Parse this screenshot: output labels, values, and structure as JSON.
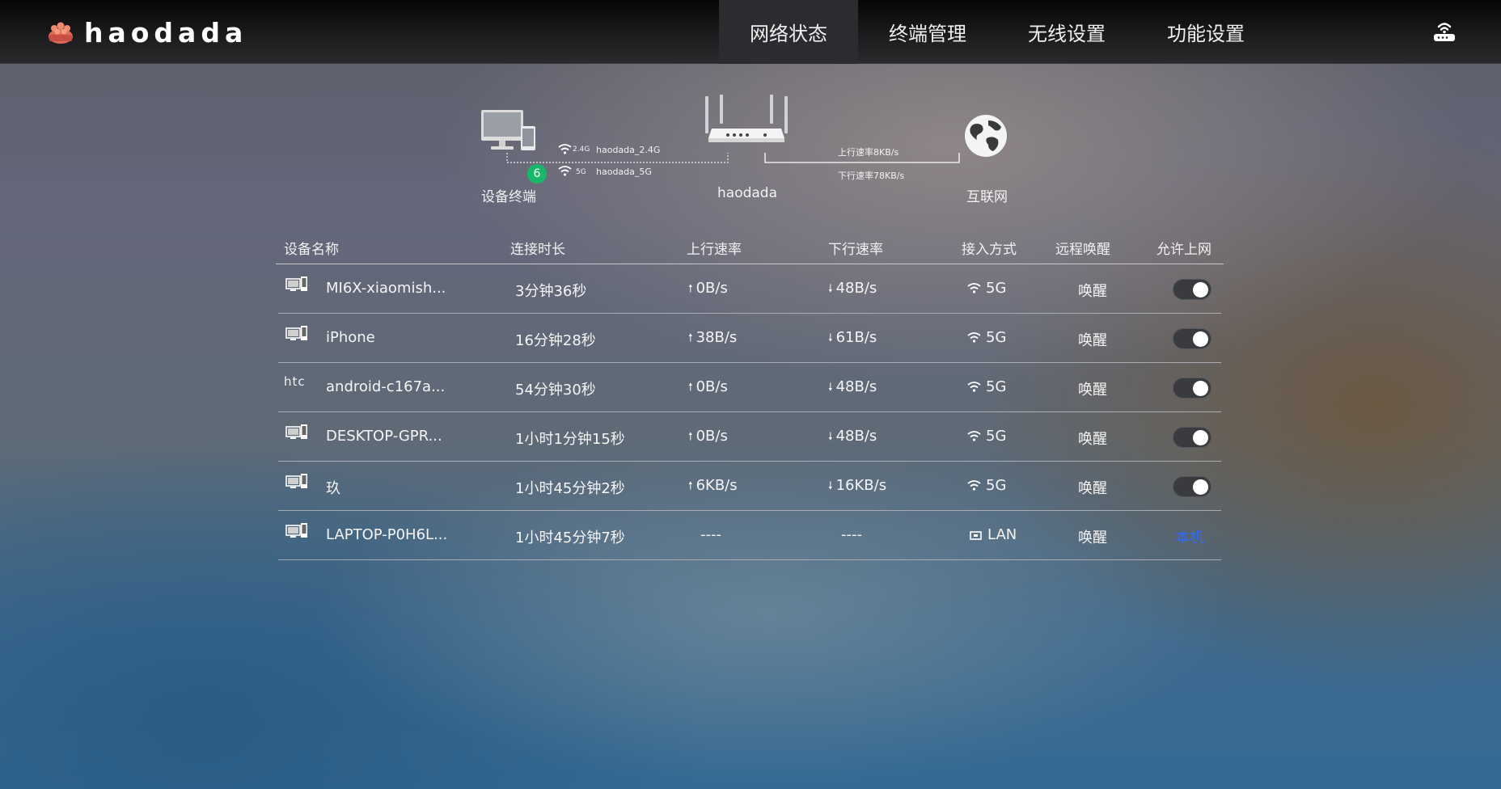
{
  "header": {
    "brand": "haodada",
    "nav": [
      {
        "label": "网络状态",
        "active": true
      },
      {
        "label": "终端管理",
        "active": false
      },
      {
        "label": "无线设置",
        "active": false
      },
      {
        "label": "功能设置",
        "active": false
      }
    ],
    "router_icon": "router-icon"
  },
  "topology": {
    "devices_label": "设备终端",
    "device_count": "6",
    "ssid_24_band": "2.4G",
    "ssid_24": "haodada_2.4G",
    "ssid_5_band": "5G",
    "ssid_5": "haodada_5G",
    "router_label": "haodada",
    "upload_rate": "上行速率8KB/s",
    "download_rate": "下行速率78KB/s",
    "internet_label": "互联网"
  },
  "table": {
    "headers": {
      "name": "设备名称",
      "duration": "连接时长",
      "up": "上行速率",
      "down": "下行速率",
      "access": "接入方式",
      "wake": "远程唤醒",
      "allow": "允许上网"
    },
    "rows": [
      {
        "icon": "pc-phone-icon",
        "name": "MI6X-xiaomish...",
        "duration": "3分钟36秒",
        "up": "0B/s",
        "down": "48B/s",
        "access": "5G",
        "wake": "唤醒",
        "allowed": true
      },
      {
        "icon": "pc-phone-icon",
        "name": "iPhone",
        "duration": "16分钟28秒",
        "up": "38B/s",
        "down": "61B/s",
        "access": "5G",
        "wake": "唤醒",
        "allowed": true
      },
      {
        "icon": "htc-logo",
        "icon_text": "htc",
        "name": "android-c167a...",
        "duration": "54分钟30秒",
        "up": "0B/s",
        "down": "48B/s",
        "access": "5G",
        "wake": "唤醒",
        "allowed": true
      },
      {
        "icon": "pc-phone-icon",
        "name": "DESKTOP-GPR...",
        "duration": "1小时1分钟15秒",
        "up": "0B/s",
        "down": "48B/s",
        "access": "5G",
        "wake": "唤醒",
        "allowed": true
      },
      {
        "icon": "pc-phone-icon",
        "name": "玖",
        "duration": "1小时45分钟2秒",
        "up": "6KB/s",
        "down": "16KB/s",
        "access": "5G",
        "wake": "唤醒",
        "allowed": true
      },
      {
        "icon": "pc-phone-icon",
        "name": "LAPTOP-P0H6L...",
        "duration": "1小时45分钟7秒",
        "up": "----",
        "down": "----",
        "access": "LAN",
        "wake": "唤醒",
        "self_label": "本机"
      }
    ]
  },
  "colors": {
    "badge": "#18b86b",
    "self_link": "#2f6bff",
    "topbar": "#1d1d1f"
  }
}
